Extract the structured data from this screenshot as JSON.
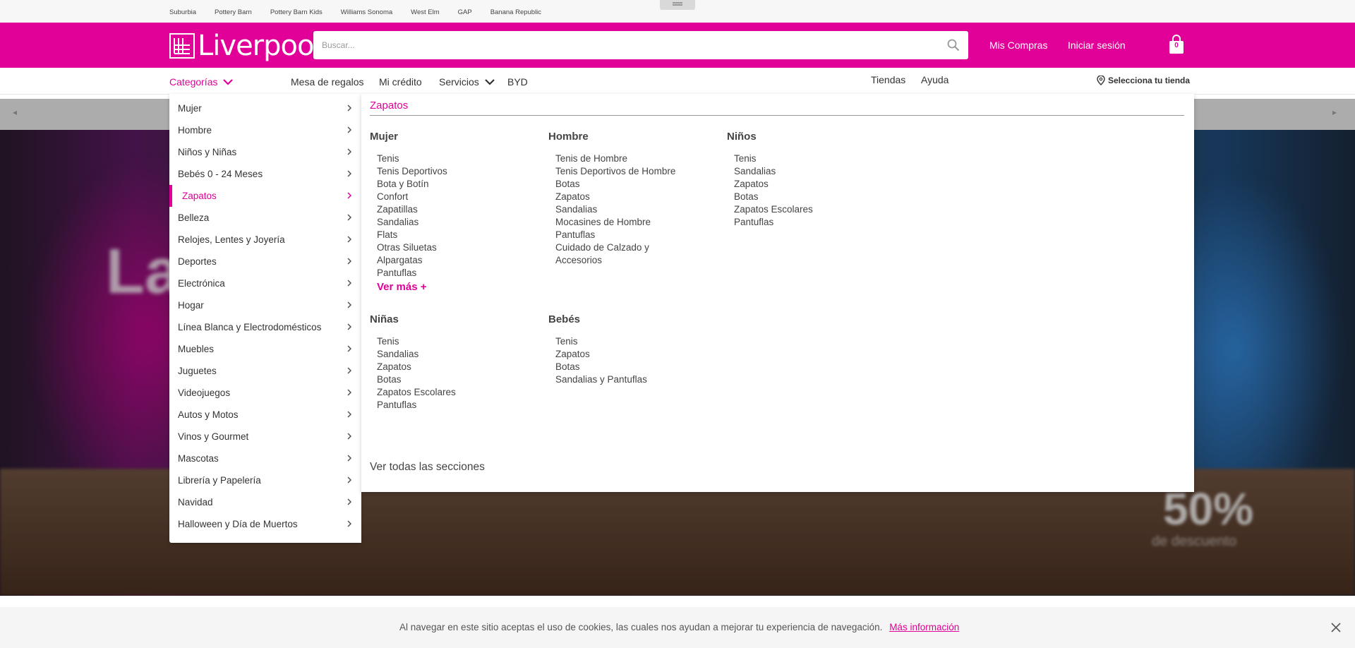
{
  "brand_bar": {
    "brands": [
      "Suburbia",
      "Pottery Barn",
      "Pottery Barn Kids",
      "Williams Sonoma",
      "West Elm",
      "GAP",
      "Banana Republic"
    ]
  },
  "header": {
    "logo_text": "Liverpool",
    "logo_tm": "®",
    "search_placeholder": "Buscar...",
    "mis_compras": "Mis Compras",
    "iniciar_sesion": "Iniciar sesión",
    "cart_count": "0"
  },
  "nav": {
    "categorias": "Categorías",
    "mesa_regalos": "Mesa de regalos",
    "mi_credito": "Mi crédito",
    "servicios": "Servicios",
    "byd": "BYD",
    "tiendas": "Tiendas",
    "ayuda": "Ayuda",
    "store_selector": "Selecciona tu tienda"
  },
  "hero": {
    "text_big": "La NO",
    "text_pct": "50%",
    "text_desc": "de descuento"
  },
  "categories": [
    "Mujer",
    "Hombre",
    "Niños y Niñas",
    "Bebés 0 - 24 Meses",
    "Zapatos",
    "Belleza",
    "Relojes, Lentes y Joyería",
    "Deportes",
    "Electrónica",
    "Hogar",
    "Línea Blanca y Electrodomésticos",
    "Muebles",
    "Juguetes",
    "Videojuegos",
    "Autos y Motos",
    "Vinos y Gourmet",
    "Mascotas",
    "Librería y Papelería",
    "Navidad",
    "Halloween y Día de Muertos"
  ],
  "active_category": "Zapatos",
  "flyout": {
    "title": "Zapatos",
    "see_all": "Ver todas las secciones",
    "columns": [
      {
        "head": "Mujer",
        "items": [
          "Tenis",
          "Tenis Deportivos",
          "Bota y Botín",
          "Confort",
          "Zapatillas",
          "Sandalias",
          "Flats",
          "Otras Siluetas",
          "Alpargatas",
          "Pantuflas"
        ],
        "more": "Ver más +"
      },
      {
        "head": "Hombre",
        "items": [
          "Tenis de Hombre",
          "Tenis Deportivos de Hombre",
          "Botas",
          "Zapatos",
          "Sandalias",
          "Mocasines de Hombre",
          "Pantuflas",
          "Cuidado de Calzado y",
          "Accesorios"
        ]
      },
      {
        "head": "Niños",
        "items": [
          "Tenis",
          "Sandalias",
          "Zapatos",
          "Botas",
          "Zapatos Escolares",
          "Pantuflas"
        ]
      },
      {
        "head": "Niñas",
        "items": [
          "Tenis",
          "Sandalias",
          "Zapatos",
          "Botas",
          "Zapatos Escolares",
          "Pantuflas"
        ]
      },
      {
        "head": "Bebés",
        "items": [
          "Tenis",
          "Zapatos",
          "Botas",
          "Sandalias y Pantuflas"
        ]
      }
    ]
  },
  "cookie": {
    "text": "Al navegar en este sitio aceptas el uso de cookies, las cuales nos ayudan a mejorar tu experiencia de navegación.",
    "link": "Más información"
  },
  "colors": {
    "brand_pink": "#e10098"
  }
}
